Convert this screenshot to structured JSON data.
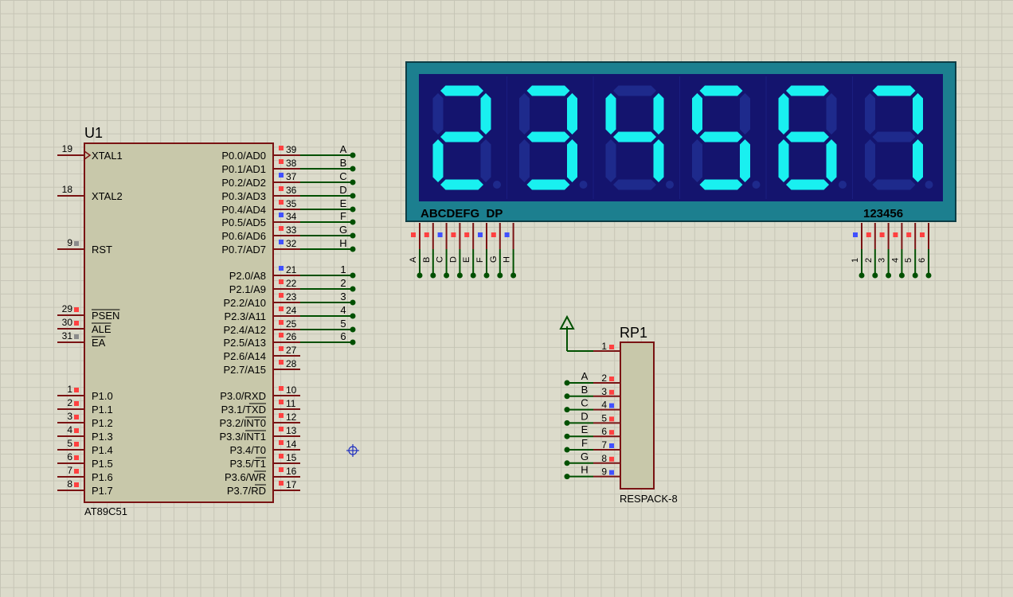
{
  "colors": {
    "grid_bg": "#dcdbcb",
    "chip_fill": "#c8c8aa",
    "chip_border": "#7a1313",
    "pin_line": "#7a1313",
    "wire": "#005000",
    "display_frame": "#1c7f8f",
    "display_face": "#14146e",
    "segment_on": "#19f0f0",
    "segment_off": "#1e2a8c",
    "pin_red": "#ff4040",
    "pin_blue": "#4050ff",
    "pin_grey": "#8c8c8c"
  },
  "u1": {
    "designator": "U1",
    "part": "AT89C51",
    "left_pins": [
      {
        "num": "19",
        "name": "XTAL1",
        "state": "none",
        "clock": true
      },
      {
        "num": "18",
        "name": "XTAL2",
        "state": "none"
      },
      {
        "num": "9",
        "name": "RST",
        "state": "grey"
      },
      {
        "num": "29",
        "name": "PSEN",
        "state": "red",
        "overline": true
      },
      {
        "num": "30",
        "name": "ALE",
        "state": "red",
        "overline": true
      },
      {
        "num": "31",
        "name": "EA",
        "state": "grey",
        "overline": true
      },
      {
        "num": "1",
        "name": "P1.0",
        "state": "red"
      },
      {
        "num": "2",
        "name": "P1.1",
        "state": "red"
      },
      {
        "num": "3",
        "name": "P1.2",
        "state": "red"
      },
      {
        "num": "4",
        "name": "P1.3",
        "state": "red"
      },
      {
        "num": "5",
        "name": "P1.4",
        "state": "red"
      },
      {
        "num": "6",
        "name": "P1.5",
        "state": "red"
      },
      {
        "num": "7",
        "name": "P1.6",
        "state": "red"
      },
      {
        "num": "8",
        "name": "P1.7",
        "state": "red"
      }
    ],
    "right_pins": [
      {
        "num": "39",
        "name": "P0.0/AD0",
        "state": "red",
        "net": "A"
      },
      {
        "num": "38",
        "name": "P0.1/AD1",
        "state": "red",
        "net": "B"
      },
      {
        "num": "37",
        "name": "P0.2/AD2",
        "state": "blue",
        "net": "C"
      },
      {
        "num": "36",
        "name": "P0.3/AD3",
        "state": "red",
        "net": "D"
      },
      {
        "num": "35",
        "name": "P0.4/AD4",
        "state": "red",
        "net": "E"
      },
      {
        "num": "34",
        "name": "P0.5/AD5",
        "state": "blue",
        "net": "F"
      },
      {
        "num": "33",
        "name": "P0.6/AD6",
        "state": "red",
        "net": "G"
      },
      {
        "num": "32",
        "name": "P0.7/AD7",
        "state": "blue",
        "net": "H"
      },
      {
        "num": "21",
        "name": "P2.0/A8",
        "state": "blue",
        "net": "1"
      },
      {
        "num": "22",
        "name": "P2.1/A9",
        "state": "red",
        "net": "2"
      },
      {
        "num": "23",
        "name": "P2.2/A10",
        "state": "red",
        "net": "3"
      },
      {
        "num": "24",
        "name": "P2.3/A11",
        "state": "red",
        "net": "4"
      },
      {
        "num": "25",
        "name": "P2.4/A12",
        "state": "red",
        "net": "5"
      },
      {
        "num": "26",
        "name": "P2.5/A13",
        "state": "red",
        "net": "6"
      },
      {
        "num": "27",
        "name": "P2.6/A14",
        "state": "red",
        "net": ""
      },
      {
        "num": "28",
        "name": "P2.7/A15",
        "state": "red",
        "net": ""
      },
      {
        "num": "10",
        "name": "P3.0/RXD",
        "state": "red",
        "net": ""
      },
      {
        "num": "11",
        "name": "P3.1/TXD",
        "state": "red",
        "net": "",
        "overline_suffix": "TXD"
      },
      {
        "num": "12",
        "name": "P3.2/INT0",
        "state": "red",
        "net": "",
        "overline_suffix": "INT0"
      },
      {
        "num": "13",
        "name": "P3.3/INT1",
        "state": "red",
        "net": "",
        "overline_suffix": "INT1"
      },
      {
        "num": "14",
        "name": "P3.4/T0",
        "state": "red",
        "net": ""
      },
      {
        "num": "15",
        "name": "P3.5/T1",
        "state": "red",
        "net": "",
        "overline_suffix": "T1"
      },
      {
        "num": "16",
        "name": "P3.6/WR",
        "state": "red",
        "net": "",
        "overline_suffix": "WR"
      },
      {
        "num": "17",
        "name": "P3.7/RD",
        "state": "red",
        "net": "",
        "overline_suffix": "RD"
      }
    ]
  },
  "display": {
    "digits": [
      "2",
      "3",
      "4",
      "5",
      "6",
      "7"
    ],
    "seg_label": "ABCDEFG  DP",
    "com_label": "123456",
    "seg_pins": [
      {
        "name": "A",
        "state": "red"
      },
      {
        "name": "B",
        "state": "red"
      },
      {
        "name": "C",
        "state": "blue"
      },
      {
        "name": "D",
        "state": "red"
      },
      {
        "name": "E",
        "state": "red"
      },
      {
        "name": "F",
        "state": "blue"
      },
      {
        "name": "G",
        "state": "red"
      },
      {
        "name": "H",
        "state": "blue"
      }
    ],
    "com_pins": [
      {
        "name": "1",
        "state": "blue"
      },
      {
        "name": "2",
        "state": "red"
      },
      {
        "name": "3",
        "state": "red"
      },
      {
        "name": "4",
        "state": "red"
      },
      {
        "name": "5",
        "state": "red"
      },
      {
        "name": "6",
        "state": "red"
      }
    ]
  },
  "rp1": {
    "designator": "RP1",
    "part": "RESPACK-8",
    "common_pin": {
      "num": "1",
      "state": "red"
    },
    "pins": [
      {
        "num": "2",
        "net": "A",
        "state": "red"
      },
      {
        "num": "3",
        "net": "B",
        "state": "red"
      },
      {
        "num": "4",
        "net": "C",
        "state": "blue"
      },
      {
        "num": "5",
        "net": "D",
        "state": "red"
      },
      {
        "num": "6",
        "net": "E",
        "state": "red"
      },
      {
        "num": "7",
        "net": "F",
        "state": "blue"
      },
      {
        "num": "8",
        "net": "G",
        "state": "red"
      },
      {
        "num": "9",
        "net": "H",
        "state": "blue"
      }
    ]
  }
}
